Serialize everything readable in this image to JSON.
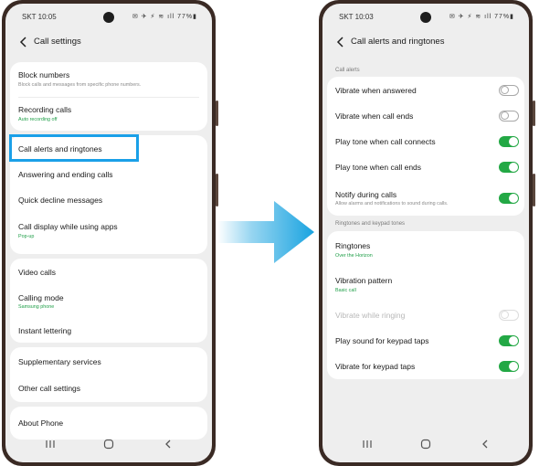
{
  "colors": {
    "highlight": "#1aa0e8",
    "toggle_on": "#23a845",
    "sub_green": "#1e9e47",
    "arrow": "#19a3e0"
  },
  "left_screen": {
    "status": {
      "carrier": "SKT",
      "time": "10:05",
      "icons": "✉ ✈ ⚡ ≋ ıll 77%▮"
    },
    "header": {
      "title": "Call settings"
    },
    "groups": [
      {
        "items": [
          {
            "label": "Block numbers",
            "sub": "Block calls and messages from specific phone numbers."
          },
          {
            "label": "Recording calls",
            "sub": "Auto recording off"
          }
        ]
      },
      {
        "items": [
          {
            "label": "Call alerts and ringtones"
          },
          {
            "label": "Answering and ending calls"
          },
          {
            "label": "Quick decline messages"
          },
          {
            "label": "Call display while using apps",
            "sub": "Pop-up"
          }
        ]
      },
      {
        "items": [
          {
            "label": "Video calls"
          },
          {
            "label": "Calling mode",
            "sub": "Samsung phone"
          },
          {
            "label": "Instant lettering"
          }
        ]
      },
      {
        "items": [
          {
            "label": "Supplementary services"
          },
          {
            "label": "Other call settings"
          }
        ]
      },
      {
        "items": [
          {
            "label": "About Phone"
          }
        ]
      }
    ]
  },
  "right_screen": {
    "status": {
      "carrier": "SKT",
      "time": "10:03",
      "icons": "✉ ✈ ⚡ ≋ ıll 77%▮"
    },
    "header": {
      "title": "Call alerts and ringtones"
    },
    "sections": [
      {
        "label": "Call alerts",
        "items": [
          {
            "label": "Vibrate when answered",
            "toggle": "off"
          },
          {
            "label": "Vibrate when call ends",
            "toggle": "off"
          },
          {
            "label": "Play tone when call connects",
            "toggle": "on"
          },
          {
            "label": "Play tone when call ends",
            "toggle": "on"
          },
          {
            "label": "Notify during calls",
            "sub": "Allow alarms and notifications to sound during calls.",
            "toggle": "on"
          }
        ]
      },
      {
        "label": "Ringtones and keypad tones",
        "items": [
          {
            "label": "Ringtones",
            "sub": "Over the Horizon"
          },
          {
            "label": "Vibration pattern",
            "sub": "Basic call"
          },
          {
            "label": "Vibrate while ringing",
            "toggle": "disabled"
          },
          {
            "label": "Play sound for keypad taps",
            "toggle": "on"
          },
          {
            "label": "Vibrate for keypad taps",
            "toggle": "on"
          }
        ]
      }
    ]
  },
  "icons": {
    "back": "back-arrow-icon",
    "nav_recent": "recent-apps-icon",
    "nav_home": "home-icon",
    "nav_back": "nav-back-icon",
    "transition": "right-arrow-icon"
  }
}
